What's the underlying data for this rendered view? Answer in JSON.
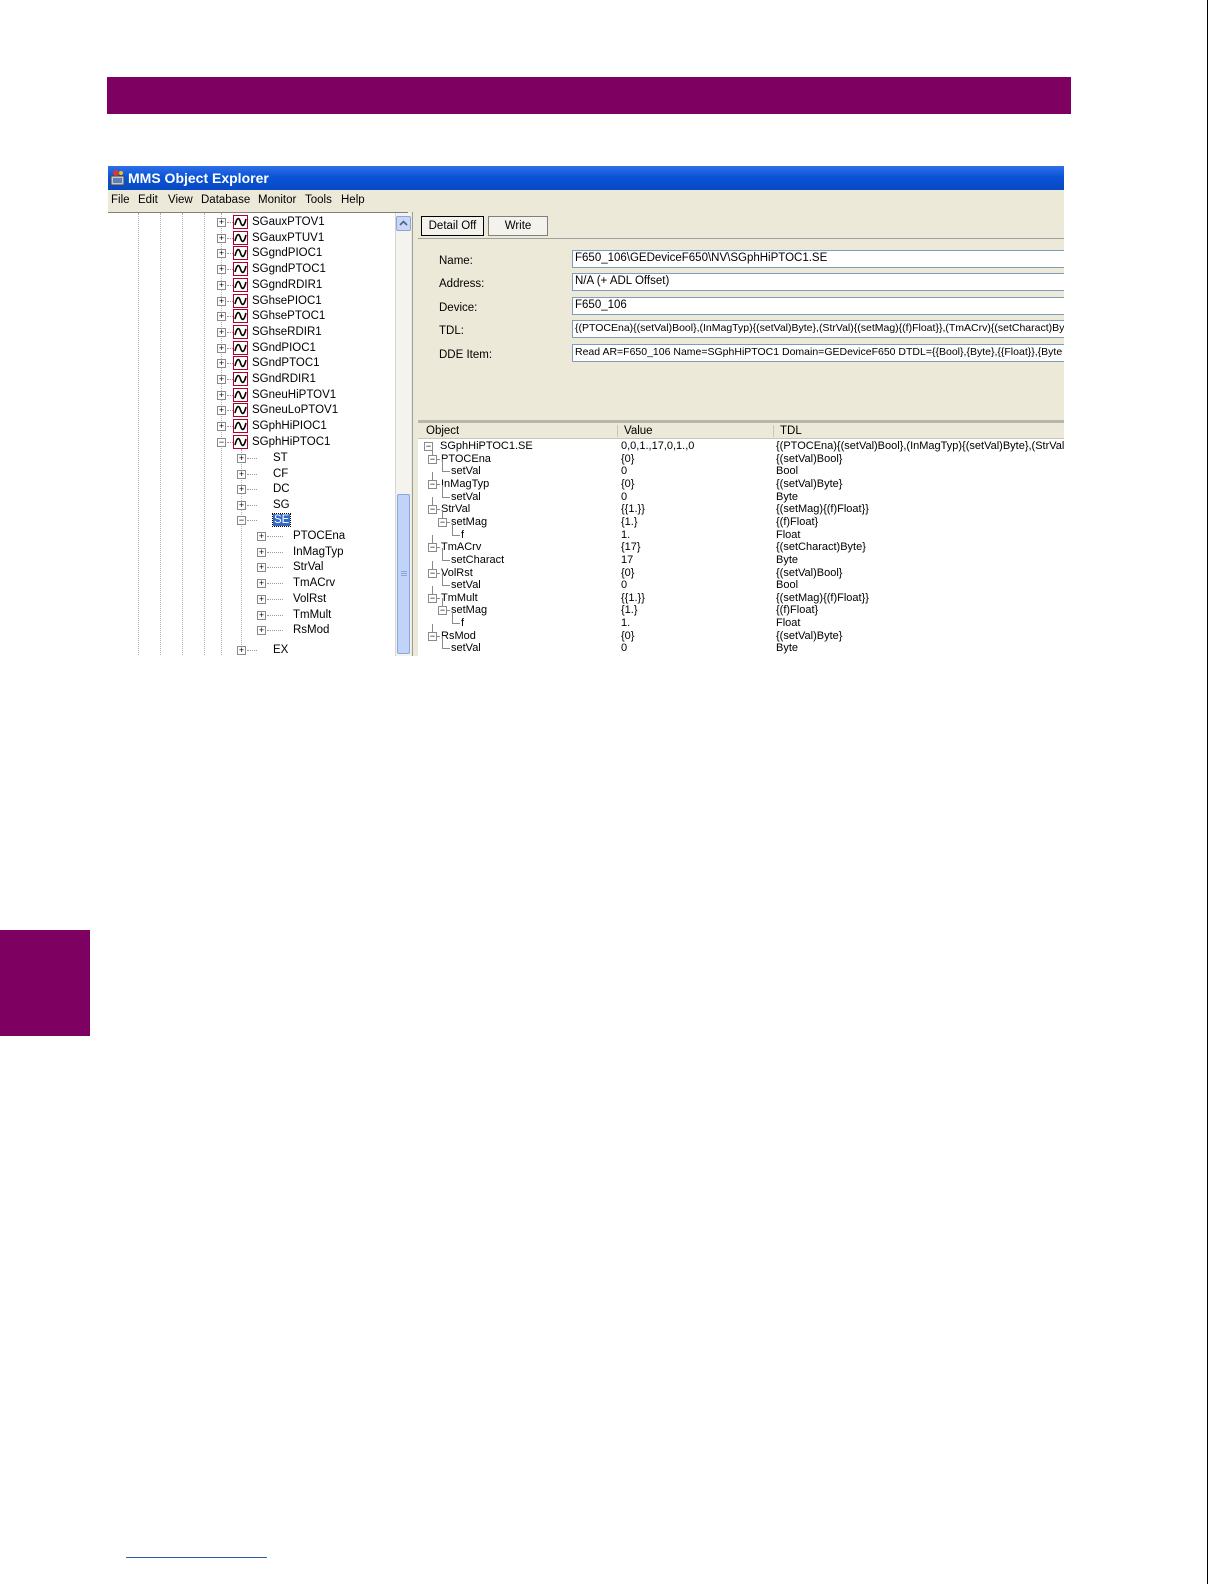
{
  "window": {
    "title": "MMS Object Explorer"
  },
  "menu": [
    "File",
    "Edit",
    "View",
    "Database",
    "Monitor",
    "Tools",
    "Help"
  ],
  "tree": {
    "nodes": [
      "SGauxPTOV1",
      "SGauxPTUV1",
      "SGgndPIOC1",
      "SGgndPTOC1",
      "SGgndRDIR1",
      "SGhsePIOC1",
      "SGhsePTOC1",
      "SGhseRDIR1",
      "SGndPIOC1",
      "SGndPTOC1",
      "SGndRDIR1",
      "SGneuHiPTOV1",
      "SGneuLoPTOV1",
      "SGphHiPIOC1",
      "SGphHiPTOC1"
    ],
    "children": [
      "ST",
      "CF",
      "DC",
      "SG",
      "SE"
    ],
    "selected": "SE",
    "grandchildren": [
      "PTOCEna",
      "InMagTyp",
      "StrVal",
      "TmACrv",
      "VolRst",
      "TmMult",
      "RsMod"
    ],
    "after": "EX"
  },
  "toolbar": {
    "detail_off": "Detail Off",
    "write": "Write"
  },
  "fields": {
    "name_label": "Name:",
    "name_value": "F650_106\\GEDeviceF650\\NV\\SGphHiPTOC1.SE",
    "address_label": "Address:",
    "address_value": "N/A (+ ADL Offset)",
    "device_label": "Device:",
    "device_value": "F650_106",
    "tdl_label": "TDL:",
    "tdl_value": "{(PTOCEna){(setVal)Bool},(InMagTyp){(setVal)Byte},(StrVal){(setMag){(f)Float}},(TmACrv){(setCharact)Byte",
    "dde_label": "DDE Item:",
    "dde_value": "Read AR=F650_106 Name=SGphHiPTOC1 Domain=GEDeviceF650 DTDL={{Bool},{Byte},{{Float}},{Byte"
  },
  "grid": {
    "columns": [
      "Object",
      "Value",
      "TDL"
    ],
    "rows": [
      {
        "object": "SGphHiPTOC1.SE",
        "value": "0,0,1.,17,0,1.,0",
        "tdl": "{(PTOCEna){(setVal)Bool},(InMagTyp){(setVal)Byte},(StrVal){(s"
      },
      {
        "object": "PTOCEna",
        "value": "{0}",
        "tdl": "{(setVal)Bool}"
      },
      {
        "object": "setVal",
        "value": "0",
        "tdl": "Bool"
      },
      {
        "object": "InMagTyp",
        "value": "{0}",
        "tdl": "{(setVal)Byte}"
      },
      {
        "object": "setVal",
        "value": "0",
        "tdl": "Byte"
      },
      {
        "object": "StrVal",
        "value": "{{1.}}",
        "tdl": "{(setMag){(f)Float}}"
      },
      {
        "object": "setMag",
        "value": "{1.}",
        "tdl": "{(f)Float}"
      },
      {
        "object": "f",
        "value": "1.",
        "tdl": "Float"
      },
      {
        "object": "TmACrv",
        "value": "{17}",
        "tdl": "{(setCharact)Byte}"
      },
      {
        "object": "setCharact",
        "value": "17",
        "tdl": "Byte"
      },
      {
        "object": "VolRst",
        "value": "{0}",
        "tdl": "{(setVal)Bool}"
      },
      {
        "object": "setVal",
        "value": "0",
        "tdl": "Bool"
      },
      {
        "object": "TmMult",
        "value": "{{1.}}",
        "tdl": "{(setMag){(f)Float}}"
      },
      {
        "object": "setMag",
        "value": "{1.}",
        "tdl": "{(f)Float}"
      },
      {
        "object": "f",
        "value": "1.",
        "tdl": "Float"
      },
      {
        "object": "RsMod",
        "value": "{0}",
        "tdl": "{(setVal)Byte}"
      },
      {
        "object": "setVal",
        "value": "0",
        "tdl": "Byte"
      }
    ]
  },
  "colors": {
    "band": "#7e0060",
    "titlebar": "#0a54d6",
    "selection": "#316ac5"
  }
}
